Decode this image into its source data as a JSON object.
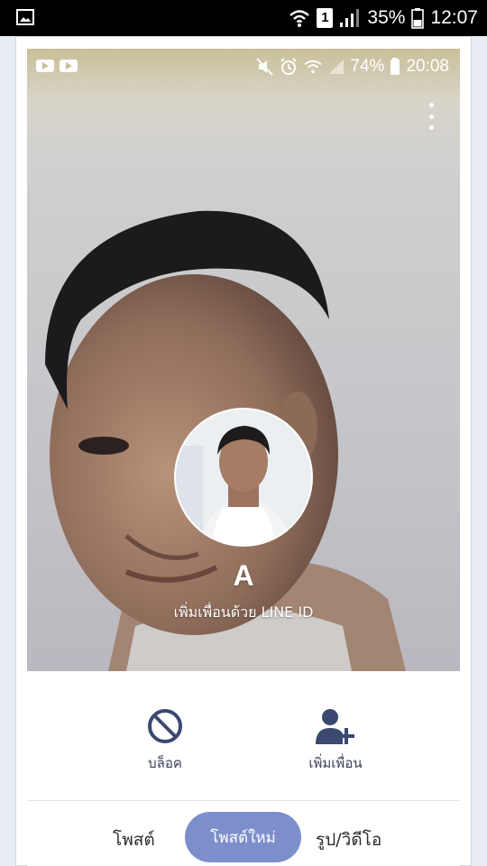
{
  "outer_status": {
    "battery": "35%",
    "clock": "12:07",
    "sim": "1",
    "icons": [
      "gallery-icon",
      "wifi-icon",
      "sim-icon",
      "signal-icon",
      "battery-icon"
    ]
  },
  "inner_status": {
    "battery": "74%",
    "clock": "20:08",
    "icons": [
      "youtube-icon",
      "youtube-icon",
      "mute-icon",
      "alarm-icon",
      "wifi-icon",
      "signal-icon",
      "battery-icon"
    ]
  },
  "profile": {
    "name": "A",
    "subtitle": "เพิ่มเพื่อนด้วย LINE ID"
  },
  "actions": {
    "block_label": "บล็อค",
    "add_friend_label": "เพิ่มเพื่อน"
  },
  "tabs": {
    "post": "โพสต์",
    "new_post": "โพสต์ใหม่",
    "media": "รูป/วิดีโอ"
  },
  "colors": {
    "accent": "#7d8fcb",
    "icon": "#3b4870",
    "frame": "#e7edf2"
  }
}
